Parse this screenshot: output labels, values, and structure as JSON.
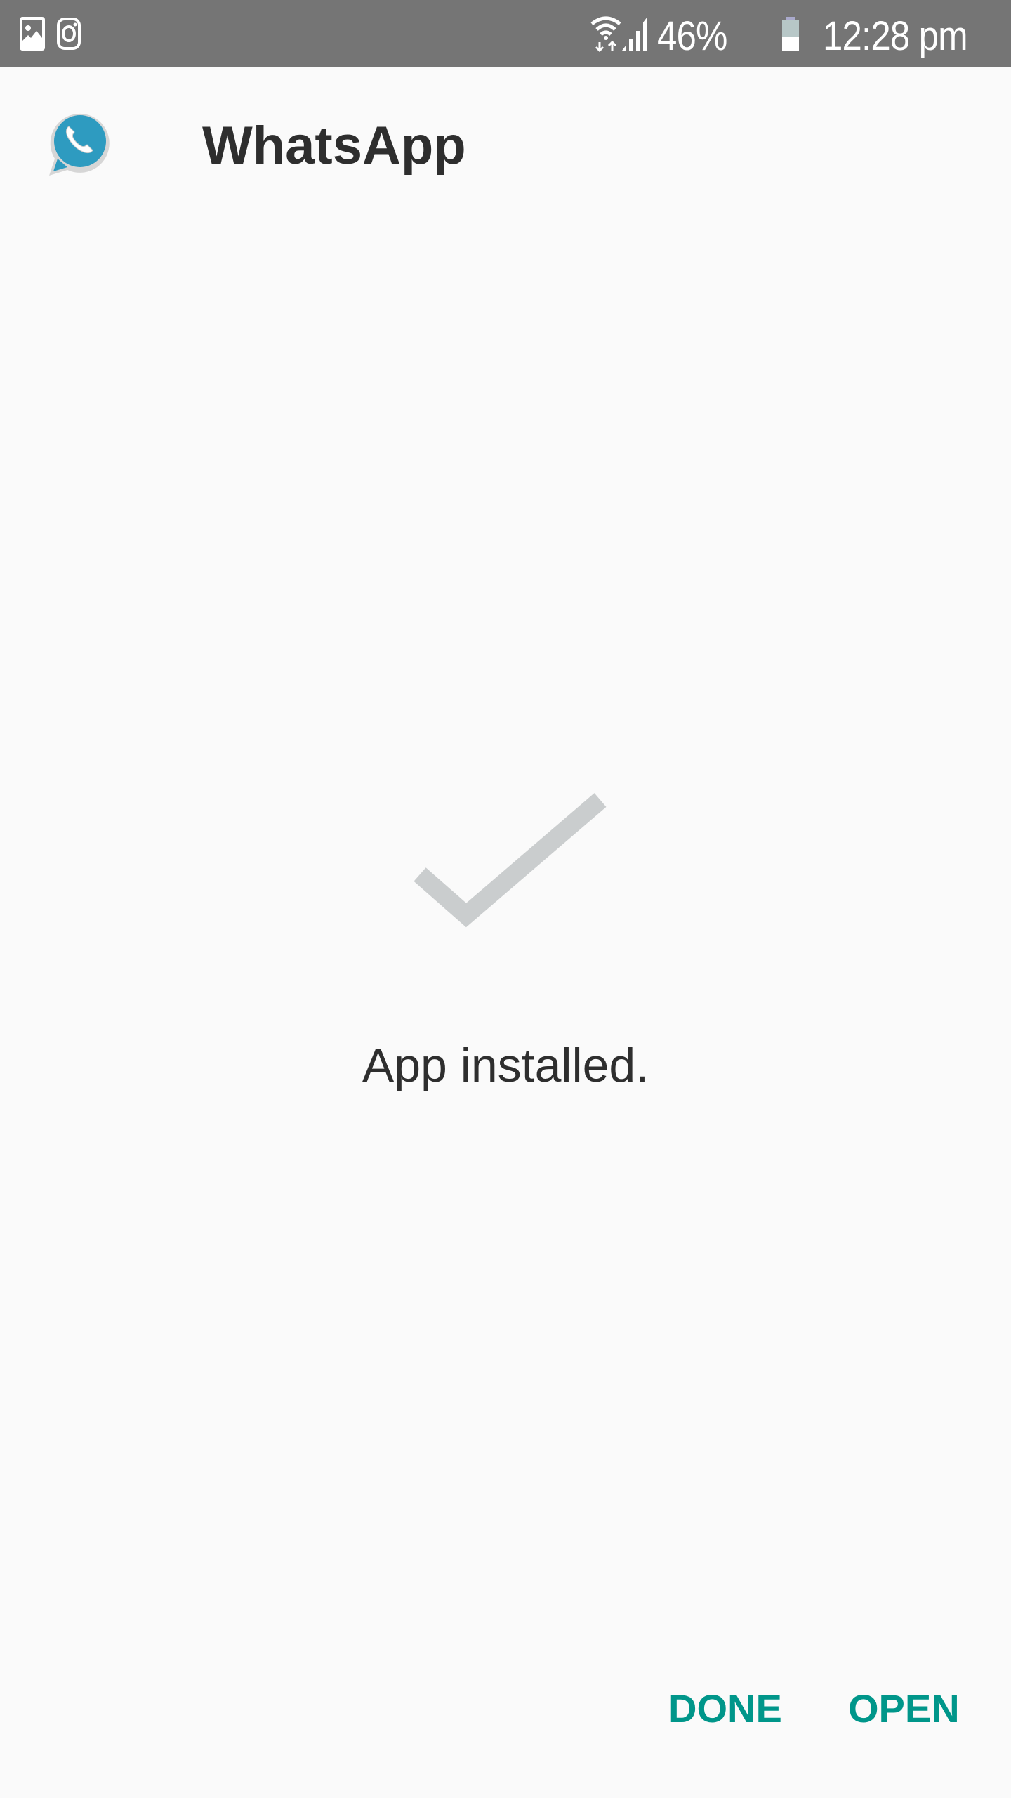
{
  "status_bar": {
    "notification_icons": [
      "gallery-icon",
      "instagram-icon"
    ],
    "wifi_icon": "wifi-data-icon",
    "signal_icon": "cell-signal-icon",
    "battery_percent": "46%",
    "battery_level": 0.46,
    "time": "12:28 pm"
  },
  "header": {
    "app_icon": "whatsapp-icon",
    "app_name": "WhatsApp"
  },
  "main": {
    "status_icon": "checkmark-icon",
    "message": "App installed."
  },
  "actions": {
    "done_label": "DONE",
    "open_label": "OPEN"
  },
  "colors": {
    "status_bar": "#757575",
    "background": "#fafafa",
    "accent": "#00968a",
    "checkmark": "#cacdce",
    "icon_blue": "#2e9bc0"
  }
}
